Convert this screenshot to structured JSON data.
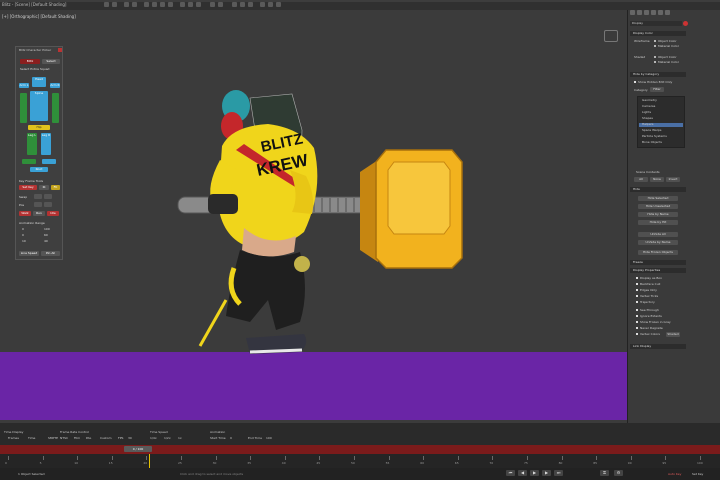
{
  "app": {
    "title": "Blitz - [Scene] [Default Shading]"
  },
  "viewport": {
    "label": "[+] [Orthographic] [Default Shading]"
  },
  "picker": {
    "title": "Blitz Character Picker",
    "tab_active": "Blitz",
    "tab_other": "Select",
    "select_all": "Select Entire Squad",
    "body_labels": [
      "Head",
      "Arm L",
      "Arm R",
      "Spine",
      "Hip",
      "Leg L",
      "Leg R",
      "Root"
    ],
    "key_label": "Key Frame Tools",
    "key_buttons": [
      "Set Key",
      "IK",
      "FK"
    ],
    "row_labels": [
      "Swap",
      "Pos",
      "Rot"
    ],
    "mode_buttons": [
      "Walk",
      "Run",
      "Idle"
    ],
    "anim_label": "Animation Range",
    "range_rows": [
      [
        "0",
        "100"
      ],
      [
        "0",
        "60"
      ],
      [
        "10",
        "40"
      ]
    ],
    "footer_buttons": [
      "Line Speed",
      "Pin All"
    ]
  },
  "right_panel": {
    "tab": "Display",
    "rollouts": [
      "Display Color",
      "Hide by Category",
      "Hide",
      "Freeze",
      "Display Properties",
      "Link Display"
    ],
    "wireframe_label": "Wireframe",
    "shaded_label": "Shaded",
    "color_options": [
      "Object Color",
      "Material Color"
    ],
    "show_hide_label": "Show Hidden Edit Only",
    "category_label": "Category",
    "category_value": "Filter",
    "categories": [
      "Geometry",
      "Cameras",
      "Lights",
      "Shapes",
      "Helpers",
      "Space Warps",
      "Particle Systems",
      "Bone Objects"
    ],
    "selected_category": "Helpers",
    "scene_contents_label": "Scene Contents",
    "all_label": "All",
    "none_label": "None",
    "invert_label": "Invert",
    "hide_buttons": [
      "Hide Selected",
      "Hide Unselected",
      "Hide by Name",
      "Hide by Hit",
      "Unhide All",
      "Unhide by Name",
      "Hide Frozen Objects"
    ],
    "props": [
      "Display as Box",
      "Backface Cull",
      "Edges Only",
      "Vertex Ticks",
      "Trajectory",
      "See-Through",
      "Ignore Extents",
      "Show Frozen in Gray",
      "Never Degrade",
      "Vertex Colors"
    ],
    "shaded_btn": "Shaded"
  },
  "bottom": {
    "time_display": "Time Display",
    "time_opts": [
      "Frames",
      "Time",
      "SMPTE"
    ],
    "frame_rate_label": "Frame Rate Control",
    "fr_opts": [
      "NTSC",
      "Film",
      "PAL",
      "Custom"
    ],
    "fps_label": "FPS",
    "fps": "30",
    "time_config_label": "Time Speed",
    "speed_opts": [
      "1/4x",
      "1/2x",
      "1x"
    ],
    "animation_label": "Animation",
    "start_label": "Start Time",
    "start": "0",
    "end_label": "End Time",
    "end": "100",
    "slider": "0 / 100",
    "status": "1 Object Selected",
    "status_hint": "Click and drag to select and move objects",
    "ticks": [
      "0",
      "5",
      "10",
      "15",
      "20",
      "25",
      "30",
      "35",
      "40",
      "45",
      "50",
      "55",
      "60",
      "65",
      "70",
      "75",
      "80",
      "85",
      "90",
      "95",
      "100"
    ],
    "autokey": "Auto Key",
    "setkey": "Set Key"
  },
  "colors": {
    "ground": "#6a25a6",
    "timebar": "#7b1b1b",
    "hammer": "#f2b21e",
    "jacket": "#f0d51b"
  }
}
